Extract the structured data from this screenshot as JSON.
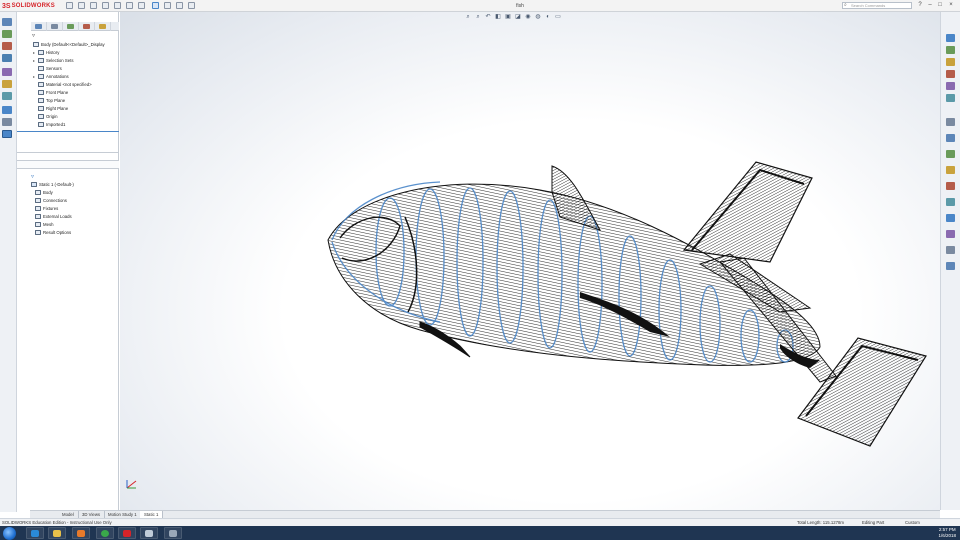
{
  "app": {
    "brand": "SOLIDWORKS",
    "brand_prefix": "3S",
    "document_title": "fish",
    "search_placeholder": "Search Commands"
  },
  "window_controls": {
    "minimize": "–",
    "restore": "□",
    "close": "×",
    "help": "?"
  },
  "feature_tree": {
    "root": "Body (Default<<Default>_Display",
    "items": [
      {
        "label": "History",
        "expand": "▸"
      },
      {
        "label": "Selection Sets",
        "expand": "▸"
      },
      {
        "label": "Sensors",
        "expand": ""
      },
      {
        "label": "Annotations",
        "expand": "▸"
      },
      {
        "label": "Material <not specified>",
        "expand": ""
      },
      {
        "label": "Front Plane",
        "expand": ""
      },
      {
        "label": "Top Plane",
        "expand": ""
      },
      {
        "label": "Right Plane",
        "expand": ""
      },
      {
        "label": "Origin",
        "expand": ""
      },
      {
        "label": "Imported1",
        "expand": ""
      }
    ]
  },
  "simulation_tree": {
    "root": "Static 1 (-Default-)",
    "items": [
      {
        "label": "Body"
      },
      {
        "label": "Connections"
      },
      {
        "label": "Fixtures"
      },
      {
        "label": "External Loads"
      },
      {
        "label": "Mesh"
      },
      {
        "label": "Result Options"
      }
    ]
  },
  "bottom_tabs": [
    {
      "label": "Model",
      "active": false
    },
    {
      "label": "3D Views",
      "active": false
    },
    {
      "label": "Motion Study 1",
      "active": false
    },
    {
      "label": "Static 1",
      "active": true
    }
  ],
  "status_bar": {
    "edition": "SOLIDWORKS Education Edition - Instructional Use Only",
    "total_length": "Total Length: 115.1278m",
    "mode": "Editing Part",
    "units": "Custom"
  },
  "taskbar": {
    "clock_time": "2:57 PM",
    "clock_date": "1/6/2018"
  },
  "colors": {
    "brand_red": "#d6242a",
    "selection_blue": "#4a86c8",
    "taskbar": "#1f3552"
  },
  "icons": [
    "search-icon",
    "zoom-fit-icon",
    "zoom-area-icon",
    "previous-view-icon",
    "section-view-icon",
    "view-orientation-icon",
    "display-style-icon",
    "hide-show-icon",
    "edit-appearance-icon",
    "apply-scene-icon",
    "view-settings-icon",
    "triad-icon",
    "start-button-icon",
    "ie-icon",
    "explorer-icon",
    "chrome-icon",
    "solidworks-icon"
  ]
}
